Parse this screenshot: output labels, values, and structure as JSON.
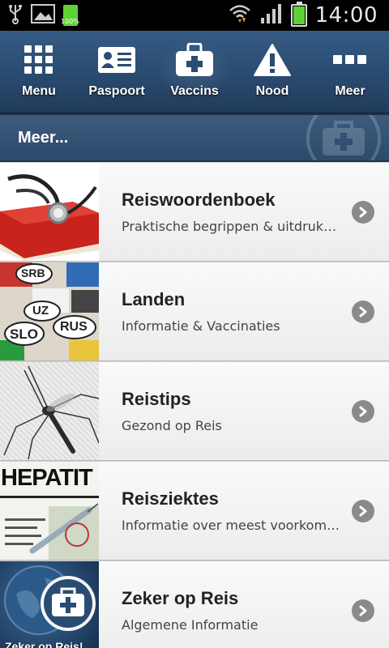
{
  "status": {
    "time": "14:00",
    "battery_label": "100%"
  },
  "nav": {
    "items": [
      {
        "label": "Menu",
        "icon": "grid-icon"
      },
      {
        "label": "Paspoort",
        "icon": "id-card-icon"
      },
      {
        "label": "Vaccins",
        "icon": "medical-kit-icon"
      },
      {
        "label": "Nood",
        "icon": "warning-icon"
      },
      {
        "label": "Meer",
        "icon": "more-dots-icon"
      }
    ]
  },
  "section": {
    "title": "Meer..."
  },
  "list": {
    "items": [
      {
        "title": "Reiswoordenboek",
        "subtitle": "Praktische begrippen & uitdrukkingen"
      },
      {
        "title": "Landen",
        "subtitle": "Informatie & Vaccinaties"
      },
      {
        "title": "Reistips",
        "subtitle": "Gezond op Reis"
      },
      {
        "title": "Reisziektes",
        "subtitle": "Informatie over meest voorkomende ziektes"
      },
      {
        "title": "Zeker op Reis",
        "subtitle": "Algemene Informatie"
      }
    ],
    "thumb_texts": {
      "hepatitis": "HEPATIT",
      "zeker": "Zeker op Reis!",
      "slo": "SLO",
      "rus": "RUS",
      "uz": "UZ",
      "srb": "SRB"
    }
  },
  "colors": {
    "nav_bg": "#2b4c72",
    "accent_battery": "#5ed134",
    "chevron": "#8a8a8a"
  }
}
